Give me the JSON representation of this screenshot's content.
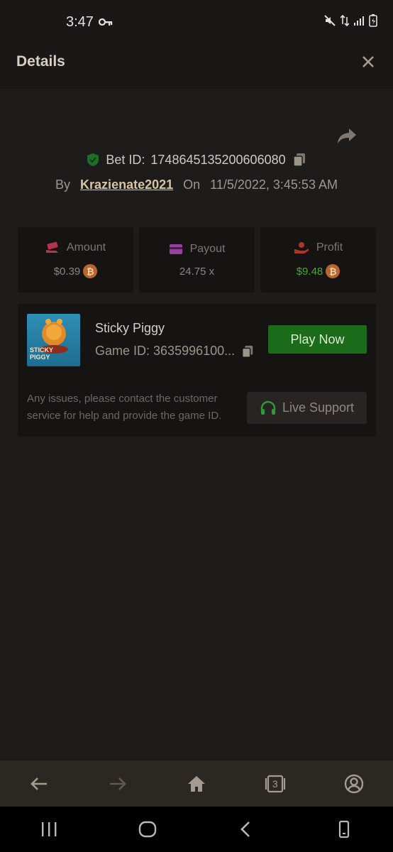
{
  "status_bar": {
    "time": "3:47",
    "icons": [
      "key-icon",
      "mute-icon",
      "data-transfer-icon",
      "signal-icon",
      "battery-icon"
    ]
  },
  "header": {
    "title": "Details",
    "close_icon": "close-icon"
  },
  "bet": {
    "id_label": "Bet ID:",
    "id_value": "1748645135200606080",
    "by_label": "By",
    "username": "Krazienate2021",
    "on_label": "On",
    "datetime": "11/5/2022, 3:45:53 AM"
  },
  "stats": {
    "amount": {
      "label": "Amount",
      "value": "$0.39",
      "icon": "bill-hand-icon",
      "icon_color": "#b8334e"
    },
    "payout": {
      "label": "Payout",
      "value": "24.75 x",
      "icon": "card-icon",
      "icon_color": "#9b3fa5"
    },
    "profit": {
      "label": "Profit",
      "value": "$9.48",
      "icon": "hand-coin-icon",
      "icon_color": "#b03528",
      "value_color": "#4aa63c"
    }
  },
  "game": {
    "name": "Sticky Piggy",
    "id_label": "Game ID:",
    "id_value": "3635996100...",
    "thumb_text": "STICKY PIGGY",
    "play_label": "Play Now",
    "notice": "Any issues, please contact the customer service for help and provide the game ID.",
    "support_label": "Live Support"
  },
  "browser_bar": {
    "tab_count": "3",
    "icons": [
      "back-arrow-icon",
      "forward-arrow-icon",
      "home-icon",
      "tabs-icon",
      "profile-icon"
    ]
  },
  "colors": {
    "background": "#1e1c1a",
    "panel": "#161412",
    "accent_green": "#1b6b1a",
    "shield_green": "#1f6e2a"
  }
}
